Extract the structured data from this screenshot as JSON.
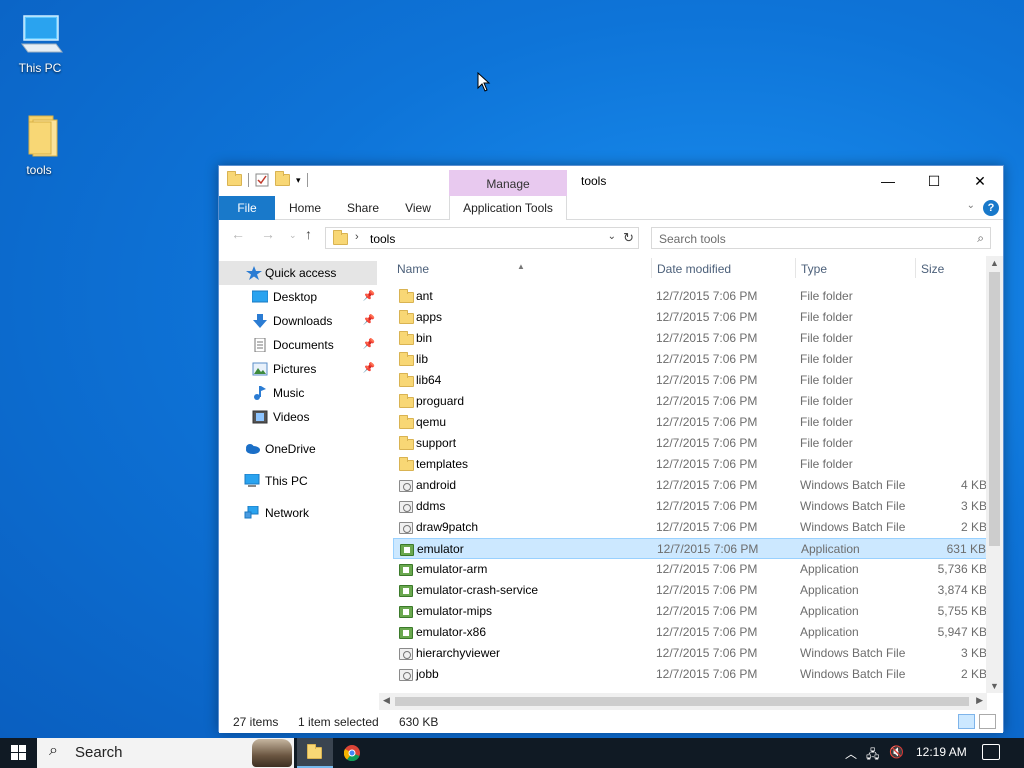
{
  "desktop": {
    "icons": [
      {
        "label": "This PC"
      },
      {
        "label": "tools"
      }
    ]
  },
  "window": {
    "title": "tools",
    "contextual_tab": "Manage",
    "ribbon_tabs": [
      "File",
      "Home",
      "Share",
      "View",
      "Application Tools"
    ],
    "address": {
      "crumb": "tools"
    },
    "search": {
      "placeholder": "Search tools"
    },
    "controls": {
      "minimize": "—",
      "maximize": "☐",
      "close": "✕"
    }
  },
  "navpane": {
    "items": [
      {
        "label": "Quick access",
        "icon": "star-icon",
        "pinned": false
      },
      {
        "label": "Desktop",
        "icon": "desktop-icon",
        "pinned": true
      },
      {
        "label": "Downloads",
        "icon": "download-icon",
        "pinned": true
      },
      {
        "label": "Documents",
        "icon": "documents-icon",
        "pinned": true
      },
      {
        "label": "Pictures",
        "icon": "pictures-icon",
        "pinned": true
      },
      {
        "label": "Music",
        "icon": "music-icon",
        "pinned": false
      },
      {
        "label": "Videos",
        "icon": "videos-icon",
        "pinned": false
      },
      {
        "label": "OneDrive",
        "icon": "cloud-icon",
        "pinned": false
      },
      {
        "label": "This PC",
        "icon": "computer-icon",
        "pinned": false
      },
      {
        "label": "Network",
        "icon": "network-icon",
        "pinned": false
      }
    ]
  },
  "filelist": {
    "columns": [
      "Name",
      "Date modified",
      "Type",
      "Size"
    ],
    "rows": [
      {
        "name": "ant",
        "date": "12/7/2015 7:06 PM",
        "type": "File folder",
        "size": "",
        "kind": "folder"
      },
      {
        "name": "apps",
        "date": "12/7/2015 7:06 PM",
        "type": "File folder",
        "size": "",
        "kind": "folder"
      },
      {
        "name": "bin",
        "date": "12/7/2015 7:06 PM",
        "type": "File folder",
        "size": "",
        "kind": "folder"
      },
      {
        "name": "lib",
        "date": "12/7/2015 7:06 PM",
        "type": "File folder",
        "size": "",
        "kind": "folder"
      },
      {
        "name": "lib64",
        "date": "12/7/2015 7:06 PM",
        "type": "File folder",
        "size": "",
        "kind": "folder"
      },
      {
        "name": "proguard",
        "date": "12/7/2015 7:06 PM",
        "type": "File folder",
        "size": "",
        "kind": "folder"
      },
      {
        "name": "qemu",
        "date": "12/7/2015 7:06 PM",
        "type": "File folder",
        "size": "",
        "kind": "folder"
      },
      {
        "name": "support",
        "date": "12/7/2015 7:06 PM",
        "type": "File folder",
        "size": "",
        "kind": "folder"
      },
      {
        "name": "templates",
        "date": "12/7/2015 7:06 PM",
        "type": "File folder",
        "size": "",
        "kind": "folder"
      },
      {
        "name": "android",
        "date": "12/7/2015 7:06 PM",
        "type": "Windows Batch File",
        "size": "4 KB",
        "kind": "batch"
      },
      {
        "name": "ddms",
        "date": "12/7/2015 7:06 PM",
        "type": "Windows Batch File",
        "size": "3 KB",
        "kind": "batch"
      },
      {
        "name": "draw9patch",
        "date": "12/7/2015 7:06 PM",
        "type": "Windows Batch File",
        "size": "2 KB",
        "kind": "batch"
      },
      {
        "name": "emulator",
        "date": "12/7/2015 7:06 PM",
        "type": "Application",
        "size": "631 KB",
        "kind": "app",
        "selected": true
      },
      {
        "name": "emulator-arm",
        "date": "12/7/2015 7:06 PM",
        "type": "Application",
        "size": "5,736 KB",
        "kind": "app"
      },
      {
        "name": "emulator-crash-service",
        "date": "12/7/2015 7:06 PM",
        "type": "Application",
        "size": "3,874 KB",
        "kind": "app"
      },
      {
        "name": "emulator-mips",
        "date": "12/7/2015 7:06 PM",
        "type": "Application",
        "size": "5,755 KB",
        "kind": "app"
      },
      {
        "name": "emulator-x86",
        "date": "12/7/2015 7:06 PM",
        "type": "Application",
        "size": "5,947 KB",
        "kind": "app"
      },
      {
        "name": "hierarchyviewer",
        "date": "12/7/2015 7:06 PM",
        "type": "Windows Batch File",
        "size": "3 KB",
        "kind": "batch"
      },
      {
        "name": "jobb",
        "date": "12/7/2015 7:06 PM",
        "type": "Windows Batch File",
        "size": "2 KB",
        "kind": "batch"
      }
    ]
  },
  "status": {
    "items_count": "27 items",
    "selected": "1 item selected",
    "selected_size": "630 KB"
  },
  "taskbar": {
    "search_label": "Search",
    "clock": "12:19 AM"
  },
  "colors": {
    "accent": "#1979ca",
    "manage_tab": "#e8c9ef",
    "selection": "#cce8ff",
    "folder": "#f8d775"
  }
}
